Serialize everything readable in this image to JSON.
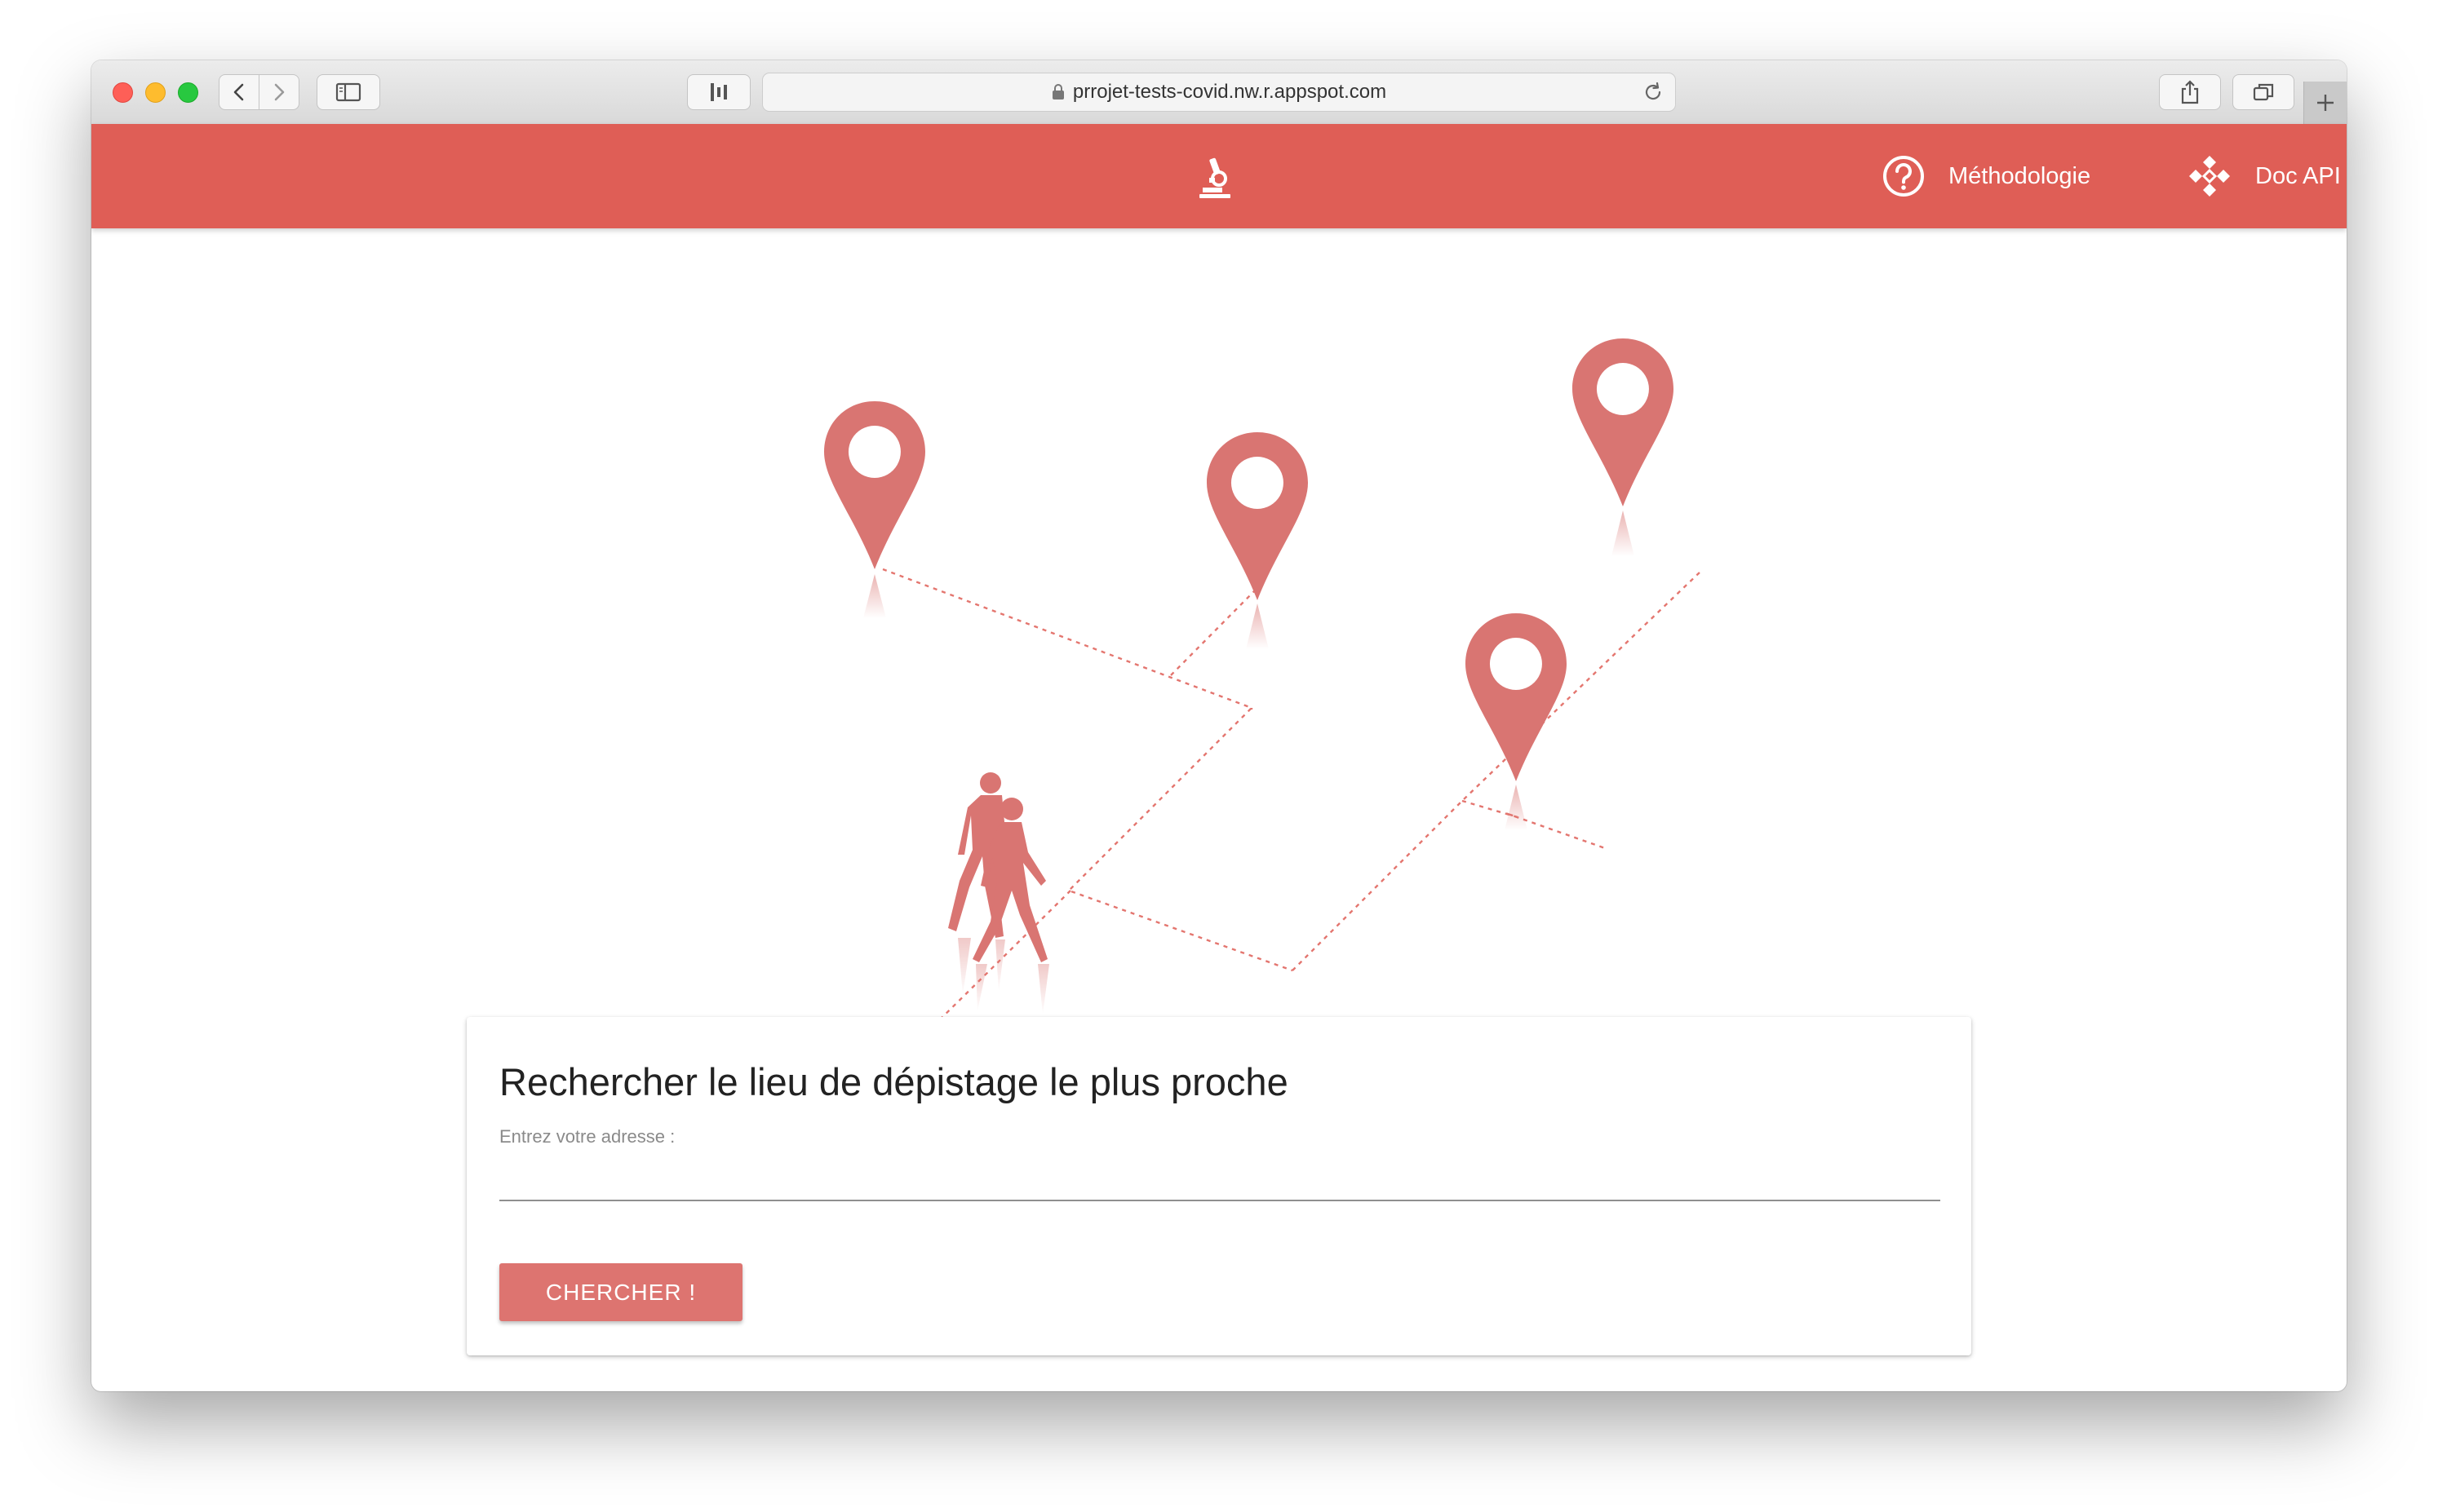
{
  "browser": {
    "url": "prrojet-tests-covid.nw.r.appspot.com",
    "back_icon": "chevron-left-icon",
    "forward_icon": "chevron-right-icon",
    "sidebar_icon": "sidebar-icon",
    "reader_icon": "reader-icon",
    "share_icon": "share-icon",
    "tabs_icon": "tabs-overview-icon",
    "new_tab_icon": "plus-icon",
    "reload_icon": "reload-icon"
  },
  "header": {
    "background": "#df5e56",
    "logo_icon": "microscope-icon",
    "nav": [
      {
        "label": "Méthodologie",
        "icon": "help-circle-icon"
      },
      {
        "label": "Doc API",
        "icon": "api-icon"
      }
    ]
  },
  "illustration": {
    "pin_color": "#d97572",
    "pin_icon": "map-pin-icon",
    "walkers_icon": "people-walking-icon"
  },
  "search": {
    "title": "Rechercher le lieu de dépistage le plus proche",
    "field_label": "Entrez votre adresse :",
    "field_value": "",
    "button_label": "CHERCHER !",
    "accent": "#dd7470"
  }
}
